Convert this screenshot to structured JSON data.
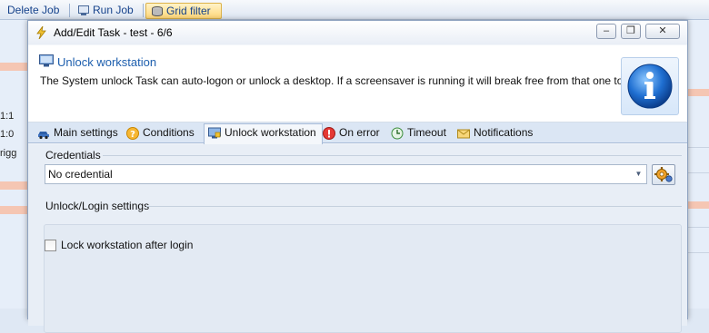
{
  "background": {
    "toolbar": {
      "delete_job": "Delete Job",
      "run_job": "Run Job",
      "grid_filter": "Grid filter"
    },
    "left_rows": [
      "1:1",
      "1:0",
      "rigg"
    ]
  },
  "dialog": {
    "title": "Add/Edit Task - test - 6/6",
    "window_buttons": {
      "minimize": "–",
      "restore": "❐",
      "close": "✕"
    },
    "header": {
      "title": "Unlock workstation",
      "description": "The System unlock Task can auto-logon or unlock a desktop. If a screensaver is running it will break free from that one too."
    },
    "tabs": [
      {
        "label": "Main settings",
        "icon": "car-icon"
      },
      {
        "label": "Conditions",
        "icon": "question-icon"
      },
      {
        "label": "Unlock workstation",
        "icon": "monitor-icon",
        "active": true
      },
      {
        "label": "On error",
        "icon": "error-icon"
      },
      {
        "label": "Timeout",
        "icon": "clock-icon"
      },
      {
        "label": "Notifications",
        "icon": "envelope-icon"
      }
    ],
    "credentials": {
      "label": "Credentials",
      "selected": "No credential"
    },
    "unlock_settings": {
      "label": "Unlock/Login settings",
      "lock_after_login_label": "Lock workstation after login",
      "lock_after_login_checked": false
    }
  }
}
